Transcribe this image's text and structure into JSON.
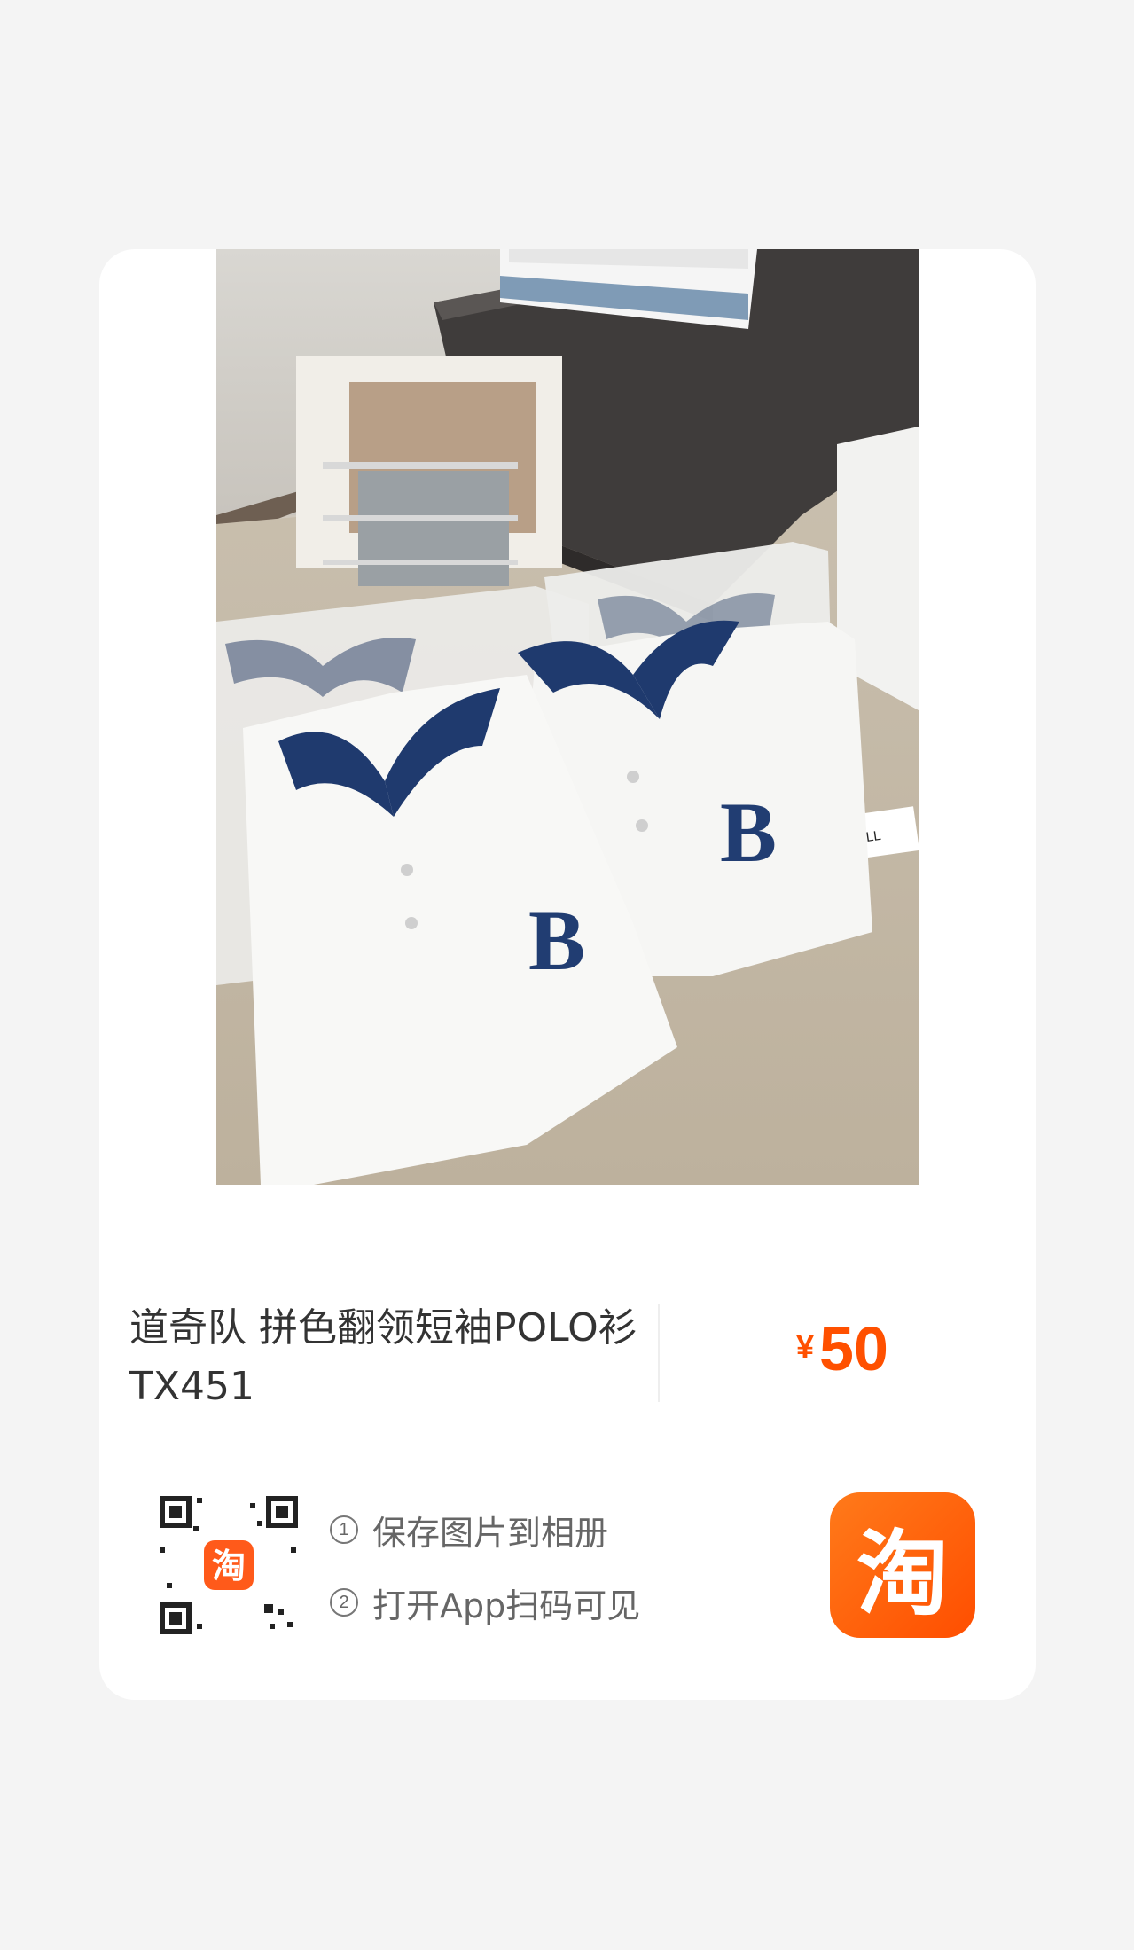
{
  "product": {
    "title": "道奇队 拼色翻领短袖POLO衫 TX451",
    "currency": "¥",
    "price": "50",
    "image_shirt_letter": "B",
    "image_label_text": "SMALL"
  },
  "share": {
    "steps": [
      {
        "num": "1",
        "text": "保存图片到相册"
      },
      {
        "num": "2",
        "text": "打开App扫码可见"
      }
    ],
    "qr_logo_text": "淘",
    "app_logo_text": "淘"
  },
  "colors": {
    "accent": "#ff5000",
    "card": "#ffffff",
    "background": "#f4f4f4",
    "collar": "#1f3a6e"
  }
}
